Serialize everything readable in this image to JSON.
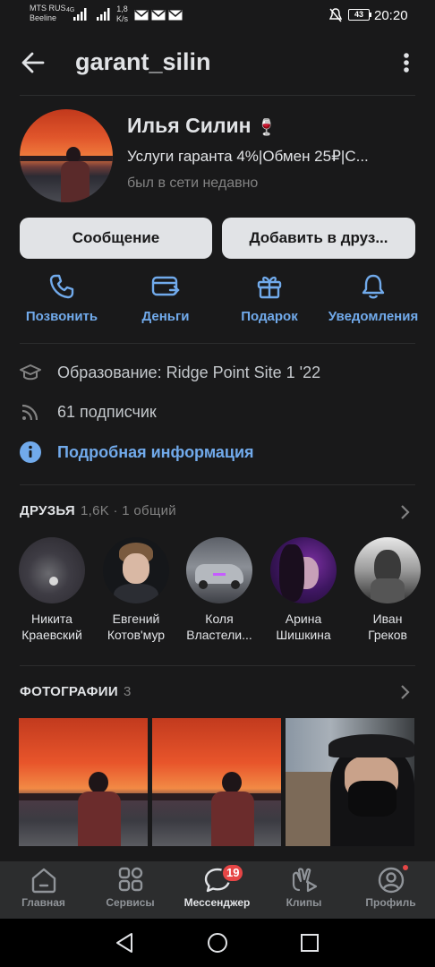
{
  "status_bar": {
    "carrier1": "MTS RUS",
    "carrier2": "Beeline",
    "net1": "4G",
    "speed": "1,8",
    "speed_unit": "K/s",
    "battery": "43",
    "time": "20:20"
  },
  "header": {
    "username": "garant_silin"
  },
  "profile": {
    "name": "Илья Силин",
    "emoji": "🍷",
    "status": "Услуги гаранта 4%|Обмен 25₽|С...",
    "last_seen": "был в сети недавно"
  },
  "buttons": {
    "message": "Сообщение",
    "add_friend": "Добавить в друз..."
  },
  "actions": [
    {
      "label": "Позвонить",
      "icon": "phone-icon"
    },
    {
      "label": "Деньги",
      "icon": "card-icon"
    },
    {
      "label": "Подарок",
      "icon": "gift-icon"
    },
    {
      "label": "Уведомления",
      "icon": "bell-icon"
    }
  ],
  "info": {
    "education": "Образование: Ridge Point Site 1 '22",
    "followers": "61 подписчик",
    "details_link": "Подробная информация"
  },
  "friends": {
    "title": "ДРУЗЬЯ",
    "count": "1,6K · 1 общий",
    "items": [
      {
        "first": "Никита",
        "last": "Краевский"
      },
      {
        "first": "Евгений",
        "last": "Котов'мур"
      },
      {
        "first": "Коля",
        "last": "Властели..."
      },
      {
        "first": "Арина",
        "last": "Шишкина"
      },
      {
        "first": "Иван",
        "last": "Греков"
      }
    ]
  },
  "photos": {
    "title": "ФОТОГРАФИИ",
    "count": "3"
  },
  "tabs": [
    {
      "label": "Главная",
      "icon": "home-icon"
    },
    {
      "label": "Сервисы",
      "icon": "services-icon"
    },
    {
      "label": "Мессенджер",
      "icon": "chat-icon",
      "badge": "19"
    },
    {
      "label": "Клипы",
      "icon": "clips-icon"
    },
    {
      "label": "Профиль",
      "icon": "profile-icon"
    }
  ],
  "colors": {
    "background": "#19191a",
    "accent": "#71aaeb",
    "button": "#e1e3e6",
    "badge": "#e64646"
  }
}
